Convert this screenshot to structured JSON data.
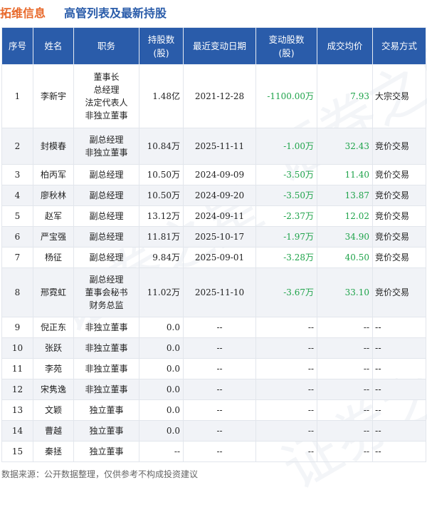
{
  "header": {
    "company": "拓维信息",
    "title": "高管列表及最新持股"
  },
  "watermark": "证券之星",
  "columns": [
    "序号",
    "姓名",
    "职务",
    "持股数(股)",
    "最近变动日期",
    "变动股数(股)",
    "成交均价",
    "交易方式"
  ],
  "rows": [
    {
      "seq": "1",
      "name": "李新宇",
      "role": [
        "董事长",
        "总经理",
        "法定代表人",
        "非独立董事"
      ],
      "shares": "1.48亿",
      "date": "2021-12-28",
      "change": "-1100.00万",
      "price": "7.93",
      "method": "大宗交易"
    },
    {
      "seq": "2",
      "name": "封模春",
      "role": [
        "副总经理",
        "非独立董事"
      ],
      "shares": "10.84万",
      "date": "2025-11-11",
      "change": "-1.00万",
      "price": "32.43",
      "method": "竞价交易"
    },
    {
      "seq": "3",
      "name": "柏丙军",
      "role": [
        "副总经理"
      ],
      "shares": "10.50万",
      "date": "2024-09-09",
      "change": "-3.50万",
      "price": "11.40",
      "method": "竞价交易"
    },
    {
      "seq": "4",
      "name": "廖秋林",
      "role": [
        "副总经理"
      ],
      "shares": "10.50万",
      "date": "2024-09-20",
      "change": "-3.50万",
      "price": "13.87",
      "method": "竞价交易"
    },
    {
      "seq": "5",
      "name": "赵军",
      "role": [
        "副总经理"
      ],
      "shares": "13.12万",
      "date": "2024-09-11",
      "change": "-2.37万",
      "price": "12.02",
      "method": "竞价交易"
    },
    {
      "seq": "6",
      "name": "严宝强",
      "role": [
        "副总经理"
      ],
      "shares": "11.81万",
      "date": "2025-10-17",
      "change": "-1.97万",
      "price": "34.90",
      "method": "竞价交易"
    },
    {
      "seq": "7",
      "name": "杨征",
      "role": [
        "副总经理"
      ],
      "shares": "9.84万",
      "date": "2025-09-01",
      "change": "-3.28万",
      "price": "40.50",
      "method": "竞价交易"
    },
    {
      "seq": "8",
      "name": "邢霓虹",
      "role": [
        "副总经理",
        "董事会秘书",
        "财务总监"
      ],
      "shares": "11.02万",
      "date": "2025-11-10",
      "change": "-3.67万",
      "price": "33.10",
      "method": "竞价交易"
    },
    {
      "seq": "9",
      "name": "倪正东",
      "role": [
        "非独立董事"
      ],
      "shares": "0.0",
      "date": "--",
      "change": "--",
      "price": "--",
      "method": "--"
    },
    {
      "seq": "10",
      "name": "张跃",
      "role": [
        "非独立董事"
      ],
      "shares": "0.0",
      "date": "--",
      "change": "--",
      "price": "--",
      "method": "--"
    },
    {
      "seq": "11",
      "name": "李苑",
      "role": [
        "非独立董事"
      ],
      "shares": "0.0",
      "date": "--",
      "change": "--",
      "price": "--",
      "method": "--"
    },
    {
      "seq": "12",
      "name": "宋隽逸",
      "role": [
        "非独立董事"
      ],
      "shares": "0.0",
      "date": "--",
      "change": "--",
      "price": "--",
      "method": "--"
    },
    {
      "seq": "13",
      "name": "文颖",
      "role": [
        "独立董事"
      ],
      "shares": "0.0",
      "date": "--",
      "change": "--",
      "price": "--",
      "method": "--"
    },
    {
      "seq": "14",
      "name": "曹越",
      "role": [
        "独立董事"
      ],
      "shares": "0.0",
      "date": "--",
      "change": "--",
      "price": "--",
      "method": "--"
    },
    {
      "seq": "15",
      "name": "秦拯",
      "role": [
        "独立董事"
      ],
      "shares": "--",
      "date": "--",
      "change": "--",
      "price": "--",
      "method": "--"
    }
  ],
  "footnote": "数据来源：公开数据整理，仅供参考不构成投资建议"
}
